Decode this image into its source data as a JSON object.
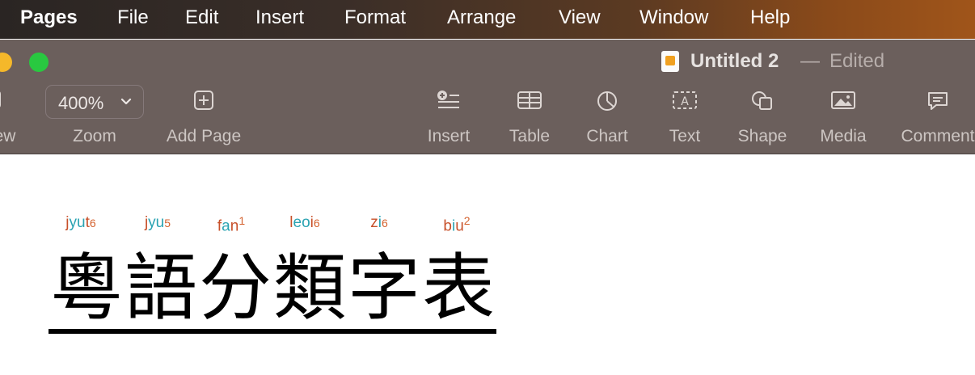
{
  "menubar": {
    "items": [
      "Pages",
      "File",
      "Edit",
      "Insert",
      "Format",
      "Arrange",
      "View",
      "Window",
      "Help"
    ]
  },
  "window": {
    "title": "Untitled 2",
    "separator": "—",
    "state": "Edited"
  },
  "toolbar": {
    "view_label": "ew",
    "zoom_value": "400%",
    "zoom_label": "Zoom",
    "add_page_label": "Add Page",
    "insert_label": "Insert",
    "table_label": "Table",
    "chart_label": "Chart",
    "text_label": "Text",
    "shape_label": "Shape",
    "media_label": "Media",
    "comment_label": "Comment",
    "icons": [
      "view-icon",
      "add-page-icon",
      "insert-icon",
      "table-icon",
      "chart-icon",
      "text-icon",
      "shape-icon",
      "media-icon",
      "comment-icon"
    ]
  },
  "document": {
    "romanizations": [
      {
        "a": "j",
        "b": "yu",
        "c": "t",
        "d": "6"
      },
      {
        "a": "j",
        "b": "yu",
        "c": "",
        "d": "5"
      },
      {
        "a": "f",
        "b": "a",
        "c": "n",
        "d": "1"
      },
      {
        "a": "l",
        "b": "eo",
        "c": "i",
        "d": "6"
      },
      {
        "a": "z",
        "b": "i",
        "c": "",
        "d": "6"
      },
      {
        "a": "b",
        "b": "i",
        "c": "u",
        "d": "2"
      }
    ],
    "heading": "粵語分類字表"
  },
  "colors": {
    "initial": "#c7502a",
    "vowel": "#2aa3b2",
    "tone": "#d4622f",
    "menubar_start": "#2a2523",
    "menubar_end": "#a0551a",
    "toolbar_bg": "#6b5f5c",
    "traffic_yellow": "#f5b82a",
    "traffic_green": "#29c840"
  }
}
